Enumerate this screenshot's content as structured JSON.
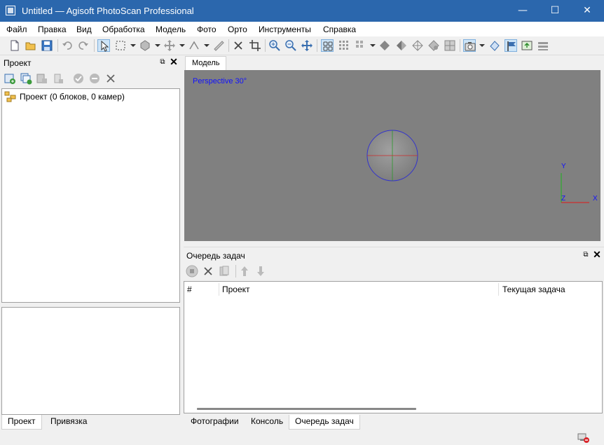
{
  "window": {
    "title": "Untitled — Agisoft PhotoScan Professional",
    "controls": {
      "minimize": "—",
      "maximize": "☐",
      "close": "✕"
    }
  },
  "menu": [
    {
      "label": "Файл"
    },
    {
      "label": "Правка"
    },
    {
      "label": "Вид"
    },
    {
      "label": "Обработка"
    },
    {
      "label": "Модель"
    },
    {
      "label": "Фото"
    },
    {
      "label": "Орто"
    },
    {
      "label": "Инструменты"
    },
    {
      "label": "Справка"
    }
  ],
  "toolbar": {
    "icons": [
      "new-icon",
      "open-icon",
      "save-icon",
      "undo-icon",
      "redo-icon",
      "select-icon",
      "rect-select-icon",
      "circle-select-icon",
      "move-icon",
      "ruler-icon",
      "measure-icon",
      "delete-icon",
      "crop-icon",
      "zoom-in-icon",
      "zoom-out-icon",
      "reset-view-icon",
      "show-cameras-icon",
      "show-points-icon",
      "show-dense-icon",
      "show-model-solid-icon",
      "show-model-shaded-icon",
      "show-model-wire-icon",
      "show-model-textured-icon",
      "show-tiled-icon",
      "show-photo-icon",
      "show-shapes-icon",
      "show-markers-icon",
      "show-region-icon",
      "show-dem-icon"
    ]
  },
  "project_panel": {
    "title": "Проект",
    "tree_root": "Проект (0 блоков, 0 камер)"
  },
  "model_view": {
    "tab_label": "Модель",
    "perspective_label": "Perspective 30°",
    "axis_labels": {
      "x": "X",
      "y": "Y",
      "z": "Z"
    }
  },
  "queue_panel": {
    "title": "Очередь задач",
    "columns": [
      "#",
      "Проект",
      "Текущая задача"
    ]
  },
  "left_tabs": [
    {
      "label": "Проект",
      "active": true
    },
    {
      "label": "Привязка",
      "active": false
    }
  ],
  "right_tabs": [
    {
      "label": "Фотографии",
      "active": false
    },
    {
      "label": "Консоль",
      "active": false
    },
    {
      "label": "Очередь задач",
      "active": true
    }
  ]
}
